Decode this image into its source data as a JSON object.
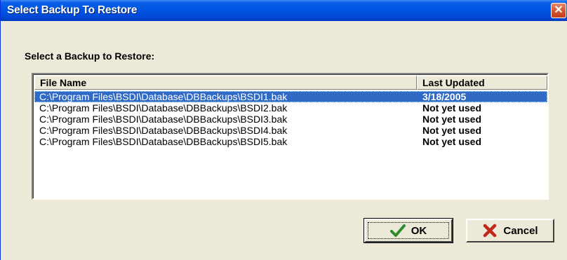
{
  "window": {
    "title": "Select Backup To Restore",
    "close_icon": "close-icon"
  },
  "dialog": {
    "prompt": "Select a Backup to Restore:"
  },
  "list": {
    "columns": [
      "File Name",
      "Last Updated"
    ],
    "rows": [
      {
        "file": "C:\\Program Files\\BSDI\\Database\\DBBackups\\BSDI1.bak",
        "updated": "3/18/2005",
        "selected": true
      },
      {
        "file": "C:\\Program Files\\BSDI\\Database\\DBBackups\\BSDI2.bak",
        "updated": "Not yet used",
        "selected": false
      },
      {
        "file": "C:\\Program Files\\BSDI\\Database\\DBBackups\\BSDI3.bak",
        "updated": "Not yet used",
        "selected": false
      },
      {
        "file": "C:\\Program Files\\BSDI\\Database\\DBBackups\\BSDI4.bak",
        "updated": "Not yet used",
        "selected": false
      },
      {
        "file": "C:\\Program Files\\BSDI\\Database\\DBBackups\\BSDI5.bak",
        "updated": "Not yet used",
        "selected": false
      }
    ]
  },
  "buttons": {
    "ok": {
      "label": "OK",
      "icon": "checkmark-icon",
      "color": "#2e8b2e"
    },
    "cancel": {
      "label": "Cancel",
      "icon": "x-mark-icon",
      "color": "#c0281c"
    }
  },
  "colors": {
    "titlebar": "#0054e3",
    "selection": "#316ac5",
    "close": "#d25430"
  }
}
